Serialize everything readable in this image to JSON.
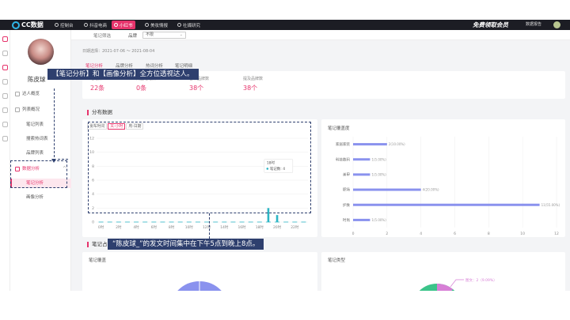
{
  "app": {
    "logo_text": "CC数据",
    "nav": [
      {
        "label": "控制台",
        "icon": "dashboard-icon"
      },
      {
        "label": "抖音电商",
        "icon": "douyin-icon"
      },
      {
        "label": "小红书",
        "icon": "xiaohongshu-icon"
      },
      {
        "label": "美妆情报",
        "icon": "beauty-icon"
      },
      {
        "label": "社媒研究",
        "icon": "research-icon"
      }
    ],
    "promo": "免费领取会员",
    "report_label": "数据报告",
    "accent_color": "#e6336b",
    "teal_color": "#2bb5c4",
    "purple_color": "#8a92ee",
    "green_color": "#3cc48a",
    "navy_color": "#2e3f6e"
  },
  "sidebar": {
    "profile_name": "陈皮球",
    "items": [
      {
        "label": "达人概览",
        "kind": "group"
      },
      {
        "label": "列表概况",
        "kind": "group"
      },
      {
        "label": "笔记列表",
        "kind": "sub"
      },
      {
        "label": "搜索热词表",
        "kind": "sub"
      },
      {
        "label": "品牌列表",
        "kind": "sub"
      },
      {
        "label": "数据分析",
        "kind": "group-open"
      },
      {
        "label": "笔记分析",
        "kind": "selected"
      },
      {
        "label": "画像分析",
        "kind": "sub"
      }
    ]
  },
  "filter": {
    "label": "笔记筛选",
    "brand_label": "品牌",
    "brand_value": "不限",
    "date_range": "日期选择：2021-07-06 ～ 2021-08-04"
  },
  "tabs": [
    "笔记分析",
    "品牌分析",
    "热词分析",
    "笔记明细"
  ],
  "stats": [
    {
      "label": "笔记数",
      "value": "22条"
    },
    {
      "label": "商业笔记数",
      "value": "0条"
    },
    {
      "label": "合作品牌数",
      "value": "38个"
    },
    {
      "label": "提及品牌数",
      "value": "38个"
    }
  ],
  "sections": {
    "distribution": "分布数据",
    "share": "笔记占比"
  },
  "dist_modes": [
    "发布时间",
    "天-小时",
    "周-日期"
  ],
  "cover_title": "笔记覆盖度",
  "share_left_title": "笔记覆盖",
  "share_right_title": "笔记类型",
  "share_right_label": "图文：2（9.09%）",
  "chart_data": [
    {
      "type": "bar",
      "title": "",
      "categories": [
        "0时",
        "1时",
        "2时",
        "3时",
        "4时",
        "5时",
        "6时",
        "7时",
        "8时",
        "9时",
        "10时",
        "11时",
        "12时",
        "13时",
        "14时",
        "15时",
        "16时",
        "17时",
        "18时",
        "19时",
        "20时",
        "21时",
        "22时",
        "23时"
      ],
      "x_tick_labels": [
        "0时",
        "2时",
        "4时",
        "6时",
        "8时",
        "10时",
        "12时",
        "14时",
        "16时",
        "18时",
        "20时",
        "22时"
      ],
      "values": [
        0,
        0,
        0,
        0,
        0,
        0,
        0,
        0,
        0,
        0,
        0,
        0,
        0,
        0,
        0,
        0,
        0,
        0,
        0,
        2,
        1,
        0,
        0,
        0
      ],
      "ylim": [
        0,
        12
      ],
      "yticks": [
        0,
        2,
        4,
        6,
        8,
        10,
        12
      ],
      "grid": true,
      "tooltip": {
        "title": "18时",
        "series_name": "笔记数",
        "value": 4
      }
    },
    {
      "type": "bar",
      "title": "笔记覆盖度",
      "orientation": "horizontal",
      "categories": [
        "家居家装",
        "科技数码",
        "美甲",
        "职场",
        "护肤",
        "时尚"
      ],
      "values": [
        2,
        1,
        1,
        4,
        11,
        1
      ],
      "value_labels": [
        "2(10.00%)",
        "1(5.00%)",
        "1(5.00%)",
        "4(20.00%)",
        "11(55.00%)",
        "1(5.00%)"
      ],
      "xlim": [
        0,
        12
      ],
      "xticks": [
        0,
        2,
        4,
        6,
        8,
        10,
        12
      ],
      "grid": true
    }
  ],
  "annotations": {
    "top_callout": "【笔记分析】和【画像分析】全方位透视达人。",
    "bottom_callout": "“陈皮球_”的发文时间集中在下午5点到晚上8点。"
  }
}
